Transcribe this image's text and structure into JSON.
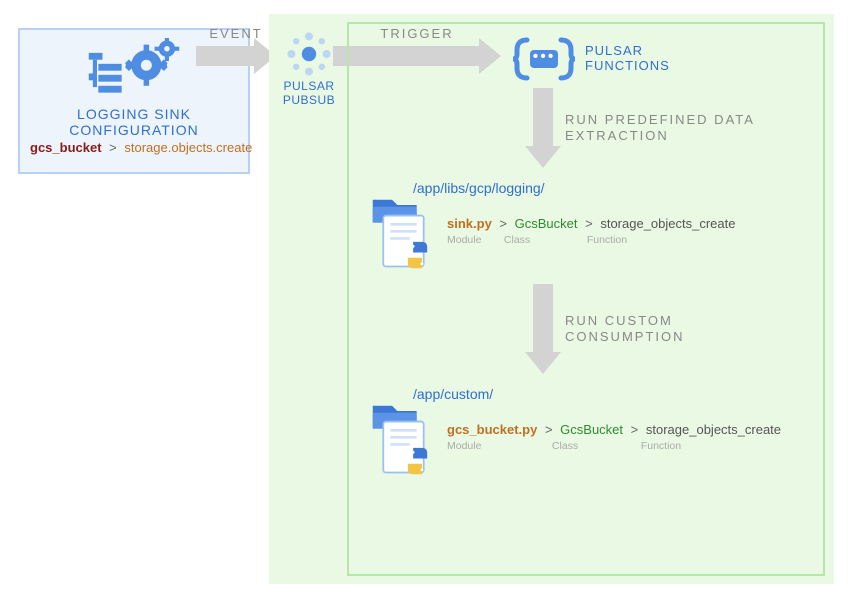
{
  "left_card": {
    "title_line1": "LOGGING SINK",
    "title_line2": "CONFIGURATION",
    "bucket": "gcs_bucket",
    "method": "storage.objects.create"
  },
  "arrows": {
    "event": "EVENT",
    "trigger": "TRIGGER",
    "extract_line1": "RUN PREDEFINED DATA",
    "extract_line2": "EXTRACTION",
    "consume_line1": "RUN CUSTOM",
    "consume_line2": "CONSUMPTION"
  },
  "pulsar_pubsub": {
    "label_line1": "PULSAR",
    "label_line2": "PUBSUB"
  },
  "pulsar_functions": {
    "label_line1": "PULSAR",
    "label_line2": "FUNCTIONS"
  },
  "builtin": {
    "path": "/app/libs/gcp/logging/",
    "module": "sink.py",
    "class": "GcsBucket",
    "function": "storage_objects_create"
  },
  "custom": {
    "path": "/app/custom/",
    "module": "gcs_bucket.py",
    "class": "GcsBucket",
    "function": "storage_objects_create"
  },
  "sublabels": {
    "module": "Module",
    "class": "Class",
    "function": "Function"
  }
}
